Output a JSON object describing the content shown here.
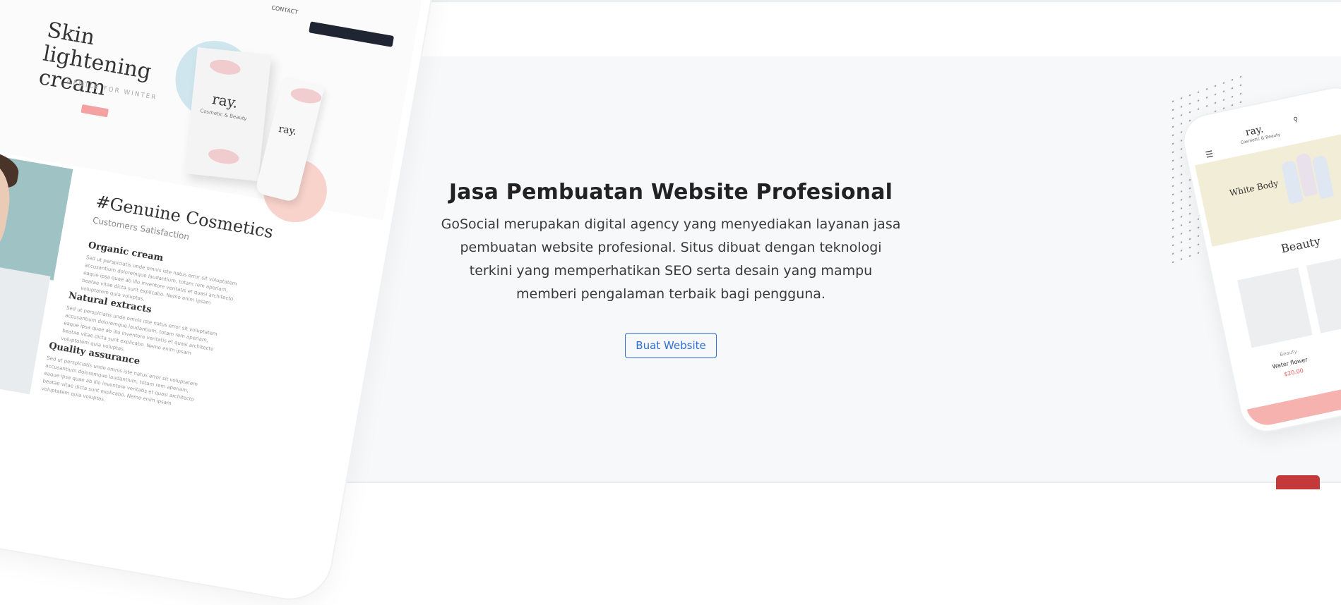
{
  "hero": {
    "title": "Jasa Pembuatan Website Profesional",
    "description": "GoSocial merupakan digital agency yang menyediakan layanan jasa pembuatan website profesional. Situs dibuat dengan teknologi terkini yang memperhatikan SEO serta desain yang mampu memberi pengalaman terbaik bagi pengguna.",
    "cta_label": "Buat Website"
  },
  "tablet_mockup": {
    "nav_text": "CONTACT",
    "headline": "Skin lightening cream",
    "subheadline": "GENTLE FOR WINTER",
    "brand": "ray.",
    "brand_sub": "Cosmetic & Beauty",
    "section_title": "#Genuine Cosmetics",
    "section_sub": "Customers Satisfaction",
    "features": [
      "Organic cream",
      "Natural extracts",
      "Quality assurance"
    ],
    "lorem": "Sed ut perspiciatis unde omnis iste natus error sit voluptatem accusantium doloremque laudantium, totam rem aperiam, eaque ipsa quae ab illo inventore veritatis et quasi architecto beatae vitae dicta sunt explicabo. Nemo enim ipsam voluptatem quia voluptas."
  },
  "phone_mockup": {
    "brand": "ray.",
    "brand_sub": "Cosmetic & Beauty",
    "banner_text": "White Body",
    "section_title": "Beauty",
    "product_category": "Beauty",
    "product_name": "Water flower",
    "product_price": "$20.00"
  },
  "colors": {
    "accent": "#2f6fd6",
    "hero_bg": "#f7f8f9",
    "floating_button": "#c43a3a"
  }
}
